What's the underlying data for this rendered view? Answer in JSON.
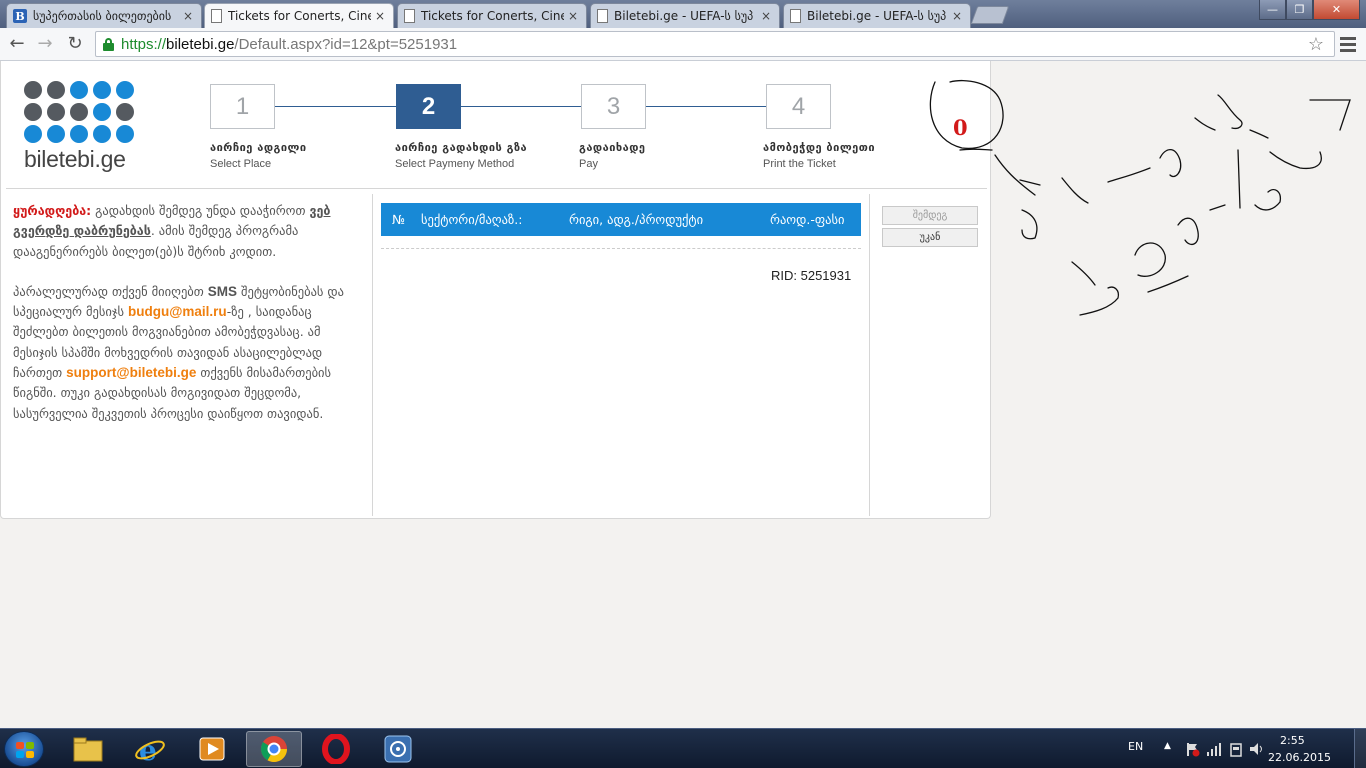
{
  "browser": {
    "tabs": [
      {
        "title": "სუპერთასის ბილეთების",
        "favicon": "B",
        "active": false
      },
      {
        "title": "Tickets for Conerts, Cinem",
        "favicon": "page",
        "active": true
      },
      {
        "title": "Tickets for Conerts, Cinem",
        "favicon": "page",
        "active": false
      },
      {
        "title": "Biletebi.ge - UEFA-ს სუპ",
        "favicon": "page",
        "active": false
      },
      {
        "title": "Biletebi.ge - UEFA-ს სუპ",
        "favicon": "page",
        "active": false
      }
    ],
    "url_protocol": "https://",
    "url_host": "biletebi.ge",
    "url_path": "/Default.aspx?id=12&pt=5251931",
    "close_glyph": "×",
    "window_min": "—",
    "window_max": "❐",
    "window_close": "✕",
    "back_glyph": "←",
    "forward_glyph": "→",
    "reload_glyph": "↻",
    "star_glyph": "☆"
  },
  "logo": {
    "text": "biletebi.ge"
  },
  "steps": [
    {
      "number": "1",
      "label_ka": "აირჩიე ადგილი",
      "label_en": "Select Place",
      "active": false
    },
    {
      "number": "2",
      "label_ka": "აირჩიე გადახდის გზა",
      "label_en": "Select Paymeny Method",
      "active": true
    },
    {
      "number": "3",
      "label_ka": "გადაიხადე",
      "label_en": "Pay",
      "active": false
    },
    {
      "number": "4",
      "label_ka": "ამობეჭდე ბილეთი",
      "label_en": "Print the Ticket",
      "active": false
    }
  ],
  "cart": {
    "count": "0"
  },
  "notice": {
    "warning_label": "ყურადღება:",
    "p1_a": " გადახდის შემდეგ უნდა დააჭიროთ ",
    "p1_link": "ვებ გვერდზე დაბრუნებას",
    "p1_b": ". ამის შემდეგ პროგრამა დააგენერირებს ბილეთ(ებ)ს შტრიხ კოდით.",
    "p2_a": "პარალელურად თქვენ მიიღებთ ",
    "p2_sms": "SMS",
    "p2_b": " შეტყობინებას და სპეციალურ მესიჯს ",
    "p2_email": "budgu@mail.ru",
    "p2_c": "-ზე , საიდანაც შეძლებთ ბილეთის მოგვიანებით ამობეჭდვასაც. ამ მესიჯის სპამში მოხვედრის თავიდან ასაცილებლად ჩართეთ ",
    "p2_support": "support@biletebi.ge",
    "p2_d": " თქვენს მისამართების წიგნში. თუკი გადახდისას მოგივიდათ შეცდომა, სასურველია შეკვეთის პროცესი დაიწყოთ თავიდან."
  },
  "table": {
    "col_no": "№",
    "col_sector": "სექტორი/მაღაზ.:",
    "col_row": "რიგი, ადგ./პროდუქტი",
    "col_qty": "რაოდ.-ფასი",
    "rid_label": "RID: 5251931"
  },
  "buttons": {
    "next": "შემდეგ",
    "back": "უკან"
  },
  "taskbar": {
    "language": "EN",
    "time": "2:55",
    "date": "22.06.2015"
  },
  "colors": {
    "accent_blue": "#1889d6",
    "step_active": "#2f5d92",
    "warning_red": "#d21a1a",
    "email_orange": "#ef7f0e"
  }
}
